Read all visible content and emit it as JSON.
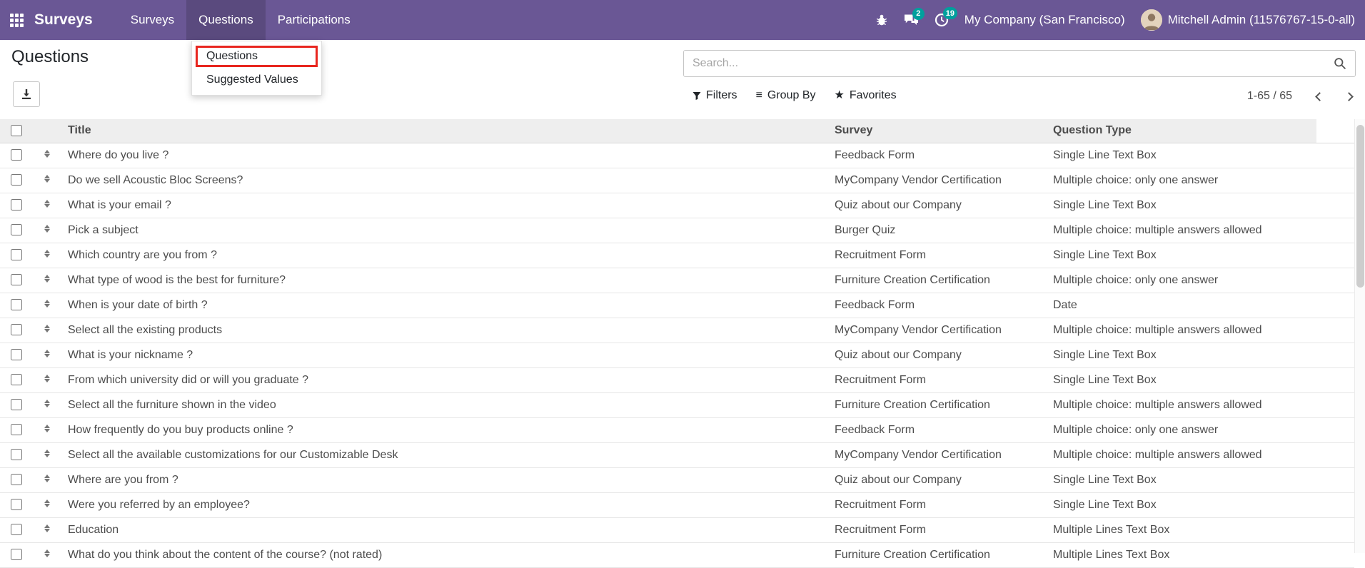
{
  "colors": {
    "navbar": "#6a5795",
    "badge": "#00a09d",
    "highlight": "#e8261f"
  },
  "navbar": {
    "brand": "Surveys",
    "menu": [
      {
        "label": "Surveys"
      },
      {
        "label": "Questions"
      },
      {
        "label": "Participations"
      }
    ],
    "systray": {
      "messages_badge": "2",
      "activities_badge": "19",
      "company": "My Company (San Francisco)",
      "user": "Mitchell Admin (11576767-15-0-all)"
    }
  },
  "menu_dropdown": {
    "items": [
      {
        "label": "Questions"
      },
      {
        "label": "Suggested Values"
      }
    ]
  },
  "page": {
    "title": "Questions"
  },
  "search": {
    "placeholder": "Search..."
  },
  "controls": {
    "filters": "Filters",
    "group_by": "Group By",
    "favorites": "Favorites"
  },
  "pager": {
    "range": "1-65 / 65"
  },
  "table": {
    "columns": [
      "Title",
      "Survey",
      "Question Type"
    ],
    "rows": [
      {
        "title": "Where do you live ?",
        "survey": "Feedback Form",
        "type": "Single Line Text Box"
      },
      {
        "title": "Do we sell Acoustic Bloc Screens?",
        "survey": "MyCompany Vendor Certification",
        "type": "Multiple choice: only one answer"
      },
      {
        "title": "What is your email ?",
        "survey": "Quiz about our Company",
        "type": "Single Line Text Box"
      },
      {
        "title": "Pick a subject",
        "survey": "Burger Quiz",
        "type": "Multiple choice: multiple answers allowed"
      },
      {
        "title": "Which country are you from ?",
        "survey": "Recruitment Form",
        "type": "Single Line Text Box"
      },
      {
        "title": "What type of wood is the best for furniture?",
        "survey": "Furniture Creation Certification",
        "type": "Multiple choice: only one answer"
      },
      {
        "title": "When is your date of birth ?",
        "survey": "Feedback Form",
        "type": "Date"
      },
      {
        "title": "Select all the existing products",
        "survey": "MyCompany Vendor Certification",
        "type": "Multiple choice: multiple answers allowed"
      },
      {
        "title": "What is your nickname ?",
        "survey": "Quiz about our Company",
        "type": "Single Line Text Box"
      },
      {
        "title": "From which university did or will you graduate ?",
        "survey": "Recruitment Form",
        "type": "Single Line Text Box"
      },
      {
        "title": "Select all the furniture shown in the video",
        "survey": "Furniture Creation Certification",
        "type": "Multiple choice: multiple answers allowed"
      },
      {
        "title": "How frequently do you buy products online ?",
        "survey": "Feedback Form",
        "type": "Multiple choice: only one answer"
      },
      {
        "title": "Select all the available customizations for our Customizable Desk",
        "survey": "MyCompany Vendor Certification",
        "type": "Multiple choice: multiple answers allowed"
      },
      {
        "title": "Where are you from ?",
        "survey": "Quiz about our Company",
        "type": "Single Line Text Box"
      },
      {
        "title": "Were you referred by an employee?",
        "survey": "Recruitment Form",
        "type": "Single Line Text Box"
      },
      {
        "title": "Education",
        "survey": "Recruitment Form",
        "type": "Multiple Lines Text Box"
      },
      {
        "title": "What do you think about the content of the course? (not rated)",
        "survey": "Furniture Creation Certification",
        "type": "Multiple Lines Text Box"
      }
    ]
  }
}
